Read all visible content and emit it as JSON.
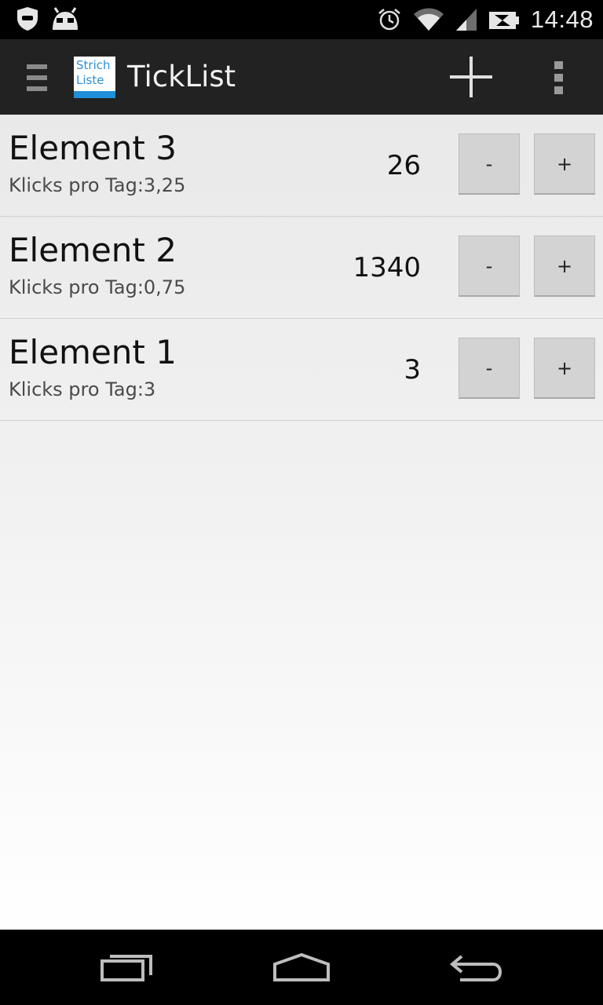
{
  "status_bar": {
    "left_icons": [
      "shield-icon",
      "android-head-icon"
    ],
    "right_icons": [
      "alarm-icon",
      "wifi-icon",
      "signal-icon",
      "battery-icon"
    ],
    "time": "14:48"
  },
  "action_bar": {
    "logo_line1": "Strich",
    "logo_line2": "Liste",
    "title": "TickList",
    "actions": [
      "add-icon",
      "overflow-menu-icon"
    ]
  },
  "list": {
    "items": [
      {
        "name": "Element 3",
        "rate": "Klicks pro Tag:3,25",
        "count": "26",
        "minus_label": "-",
        "plus_label": "+"
      },
      {
        "name": "Element 2",
        "rate": "Klicks pro Tag:0,75",
        "count": "1340",
        "minus_label": "-",
        "plus_label": "+"
      },
      {
        "name": "Element 1",
        "rate": "Klicks pro Tag:3",
        "count": "3",
        "minus_label": "-",
        "plus_label": "+"
      }
    ]
  },
  "nav_bar": {
    "buttons": [
      "recent-apps-icon",
      "home-icon",
      "back-icon"
    ]
  },
  "colors": {
    "action_bar_bg": "#222222",
    "logo_accent": "#1e8fd8",
    "button_bg": "#d3d3d3"
  }
}
